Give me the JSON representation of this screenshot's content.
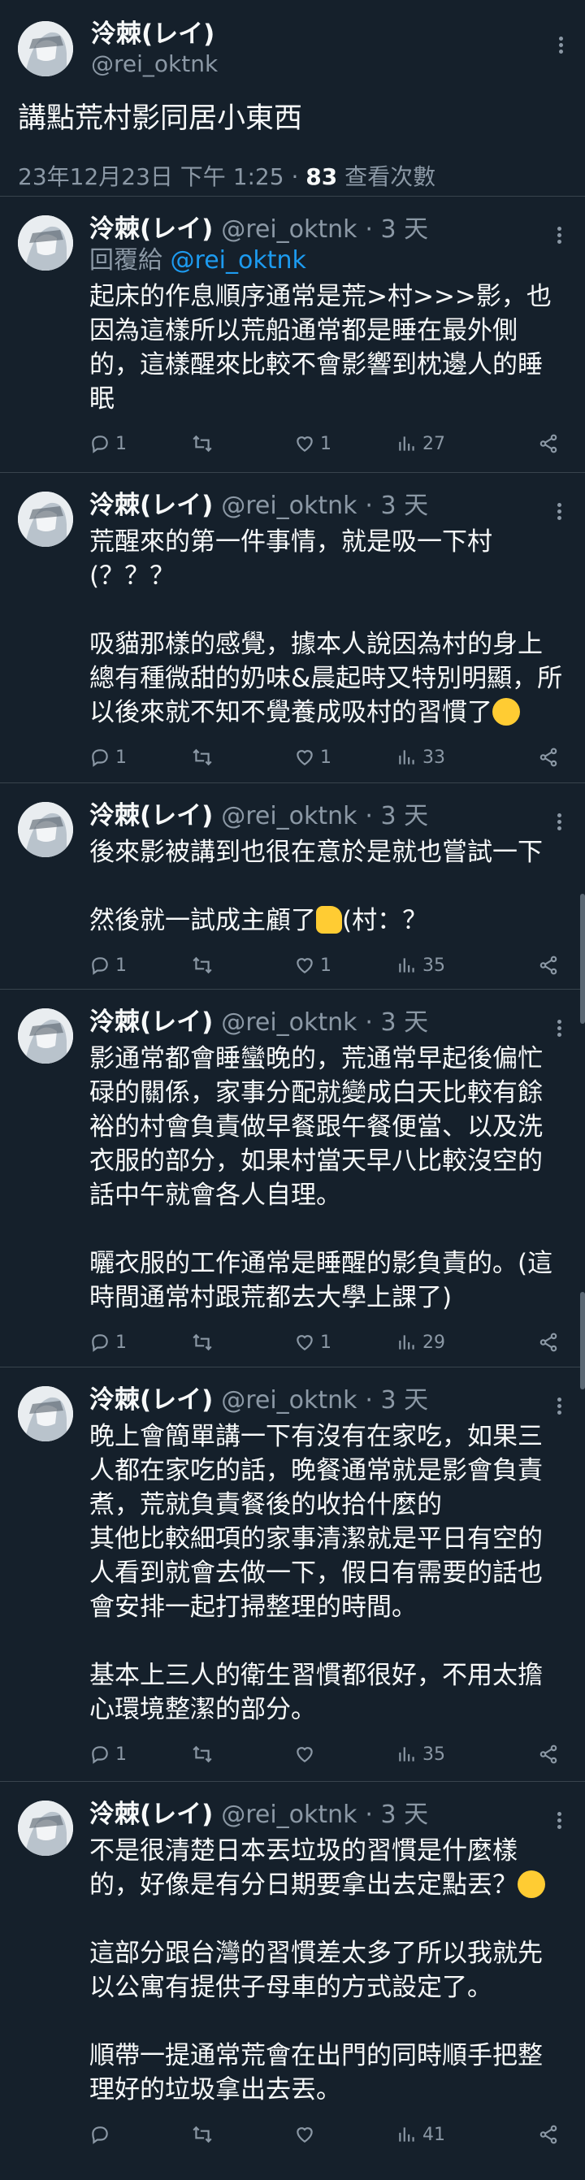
{
  "author": {
    "name": "泠棘(レイ)",
    "handle": "@rei_oktnk"
  },
  "main": {
    "text": "講點荒村影同居小東西",
    "timestamp": "23年12月23日 下午 1:25",
    "sep": " · ",
    "views_count": "83",
    "views_label": " 查看次數"
  },
  "replies": [
    {
      "time": "· 3 天",
      "reply_to_label": "回覆給 ",
      "reply_to_handle": "@rei_oktnk",
      "text": "起床的作息順序通常是荒>村>>>影，也因為這樣所以荒船通常都是睡在最外側的，這樣醒來比較不會影響到枕邊人的睡眠",
      "replies": "1",
      "retweets": "",
      "likes": "1",
      "views": "27"
    },
    {
      "time": "· 3 天",
      "text": "荒醒來的第一件事情，就是吸一下村(？？？\n\n吸貓那樣的感覺，據本人說因為村的身上總有種微甜的奶味&晨起時又特別明顯，所以後來就不知不覺養成吸村的習慣了",
      "replies": "1",
      "retweets": "",
      "likes": "1",
      "views": "33"
    },
    {
      "time": "· 3 天",
      "text_a": "後來影被講到也很在意於是就也嘗試一下\n\n然後就一試成主顧了",
      "text_b": "(村：？",
      "replies": "1",
      "retweets": "",
      "likes": "1",
      "views": "35"
    },
    {
      "time": "· 3 天",
      "text": "影通常都會睡蠻晚的，荒通常早起後偏忙碌的關係，家事分配就變成白天比較有餘裕的村會負責做早餐跟午餐便當、以及洗衣服的部分，如果村當天早八比較沒空的話中午就會各人自理。\n\n曬衣服的工作通常是睡醒的影負責的。(這時間通常村跟荒都去大學上課了)",
      "replies": "1",
      "retweets": "",
      "likes": "1",
      "views": "29"
    },
    {
      "time": "· 3 天",
      "text": "晚上會簡單講一下有沒有在家吃，如果三人都在家吃的話，晚餐通常就是影會負責煮，荒就負責餐後的收拾什麼的\n其他比較細項的家事清潔就是平日有空的人看到就會去做一下，假日有需要的話也會安排一起打掃整理的時間。\n\n基本上三人的衛生習慣都很好，不用太擔心環境整潔的部分。",
      "replies": "1",
      "retweets": "",
      "likes": "",
      "views": "35"
    },
    {
      "time": "· 3 天",
      "text_a": "不是很清楚日本丟垃圾的習慣是什麼樣的，好像是有分日期要拿出去定點丟？",
      "text_b": "\n\n這部分跟台灣的習慣差太多了所以我就先以公寓有提供子母車的方式設定了。\n\n順帶一提通常荒會在出門的同時順手把整理好的垃圾拿出去丟。",
      "replies": "",
      "retweets": "",
      "likes": "",
      "views": "41"
    }
  ]
}
